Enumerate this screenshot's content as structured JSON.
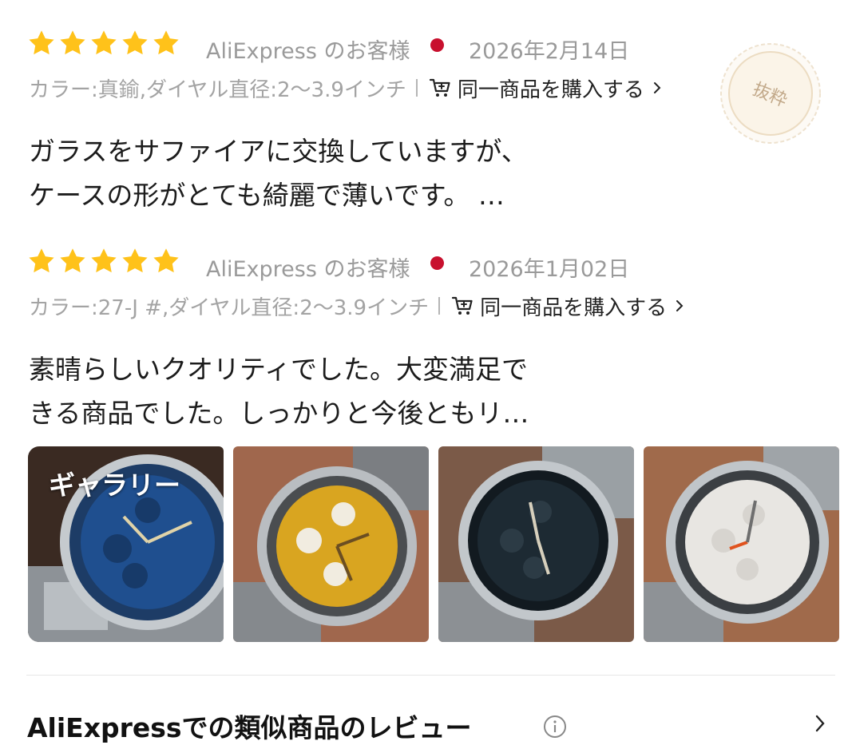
{
  "reviews": [
    {
      "rating": 5,
      "reviewer": "AliExpress のお客様",
      "country_flag_color": "#c8102e",
      "date": "2026年2月14日",
      "sku": "カラー:真鍮,ダイヤル直径:2～3.9インチ",
      "buy_label": "同一商品を購入する",
      "text_line1": "ガラスをサファイアに交換していますが、",
      "text_line2": "ケースの形がとても綺麗で薄いです。 …",
      "badge": "抜粋"
    },
    {
      "rating": 5,
      "reviewer": "AliExpress のお客様",
      "country_flag_color": "#c8102e",
      "date": "2026年1月02日",
      "sku": "カラー:27-J #,ダイヤル直径:2～3.9インチ",
      "buy_label": "同一商品を購入する",
      "text_line1": "素晴らしいクオリティでした。大変満足で",
      "text_line2": "きる商品でした。しっかりと今後ともリ…"
    }
  ],
  "gallery": {
    "label": "ギャラリー",
    "images": [
      {
        "dial": "blue",
        "dial_color": "#1f4f8f"
      },
      {
        "dial": "yellow",
        "dial_color": "#d9a520"
      },
      {
        "dial": "black",
        "dial_color": "#1d2a33"
      },
      {
        "dial": "white",
        "dial_color": "#e8e6e2"
      }
    ]
  },
  "section": {
    "title": "AliExpressでの類似商品のレビュー"
  },
  "colors": {
    "star": "#ffc21a",
    "accent_red": "#c8102e",
    "muted_text": "#9a9a9a"
  }
}
